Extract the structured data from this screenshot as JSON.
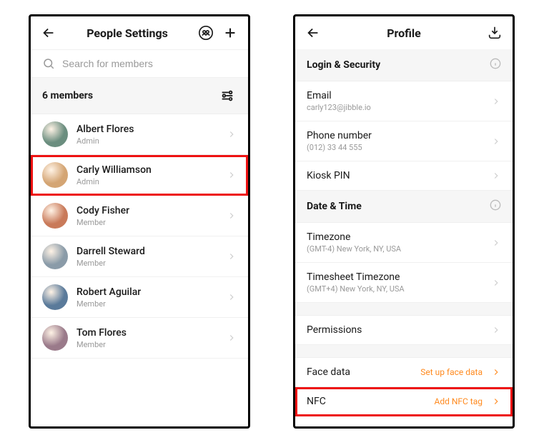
{
  "left": {
    "title": "People Settings",
    "search_placeholder": "Search for members",
    "members_label": "6 members",
    "members": [
      {
        "name": "Albert Flores",
        "role": "Admin",
        "hl": false
      },
      {
        "name": "Carly Williamson",
        "role": "Admin",
        "hl": true
      },
      {
        "name": "Cody Fisher",
        "role": "Member",
        "hl": false
      },
      {
        "name": "Darrell Steward",
        "role": "Member",
        "hl": false
      },
      {
        "name": "Robert Aguilar",
        "role": "Member",
        "hl": false
      },
      {
        "name": "Tom Flores",
        "role": "Member",
        "hl": false
      }
    ]
  },
  "right": {
    "title": "Profile",
    "sections": {
      "login_security": "Login & Security",
      "date_time": "Date & Time"
    },
    "email_label": "Email",
    "email_value": "carly123@jibble.io",
    "phone_label": "Phone number",
    "phone_value": "(012) 33 44 555",
    "kiosk_label": "Kiosk PIN",
    "tz_label": "Timezone",
    "tz_value": "(GMT-4) New York, NY, USA",
    "tstz_label": "Timesheet Timezone",
    "tstz_value": "(GMT+4) New York, NY, USA",
    "perm_label": "Permissions",
    "face_label": "Face data",
    "face_action": "Set up face data",
    "nfc_label": "NFC",
    "nfc_action": "Add NFC tag"
  },
  "avatar_colors": [
    "#6b8e7f",
    "#d4a574",
    "#c97a5a",
    "#8a9ba8",
    "#5a7a9a",
    "#9a7a8a"
  ]
}
